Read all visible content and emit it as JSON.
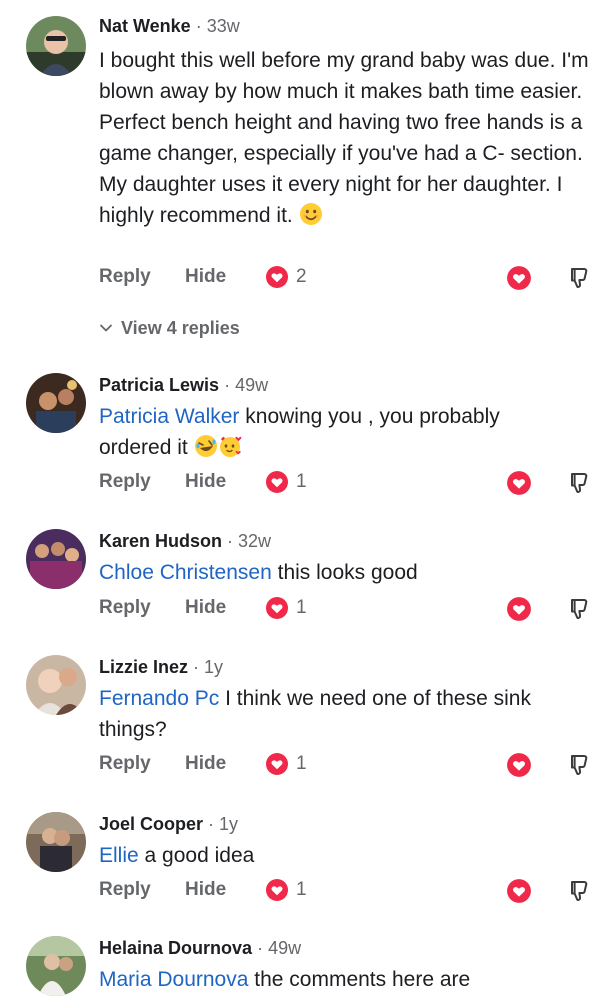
{
  "actions": {
    "reply_label": "Reply",
    "hide_label": "Hide"
  },
  "view_replies_label": "View 4 replies",
  "colors": {
    "mention": "#1f65c4",
    "reaction": "#f0284a",
    "meta": "#65676b"
  },
  "comments": [
    {
      "name": "Nat Wenke",
      "time": "33w",
      "mention": "",
      "text": "I bought this well before my grand baby was due. I'm blown away by how much it makes bath time easier. Perfect bench height and having two free hands is a game changer, especially if you've had a C- section. My daughter uses it every night for her daughter. I highly recommend it.",
      "reaction_count": "2"
    },
    {
      "name": "Patricia Lewis",
      "time": "49w",
      "mention": "Patricia Walker",
      "text": "knowing you , you probably ordered it",
      "reaction_count": "1"
    },
    {
      "name": "Karen Hudson",
      "time": "32w",
      "mention": "Chloe Christensen",
      "text": "this looks good",
      "reaction_count": "1"
    },
    {
      "name": "Lizzie Inez",
      "time": "1y",
      "mention": "Fernando Pc",
      "text": "I think we need one of these sink things?",
      "reaction_count": "1"
    },
    {
      "name": "Joel Cooper",
      "time": "1y",
      "mention": "Ellie",
      "text": "a good idea",
      "reaction_count": "1"
    },
    {
      "name": "Helaina Dournova",
      "time": "49w",
      "mention": "Maria Dournova",
      "text": "the comments here are",
      "reaction_count": ""
    }
  ]
}
